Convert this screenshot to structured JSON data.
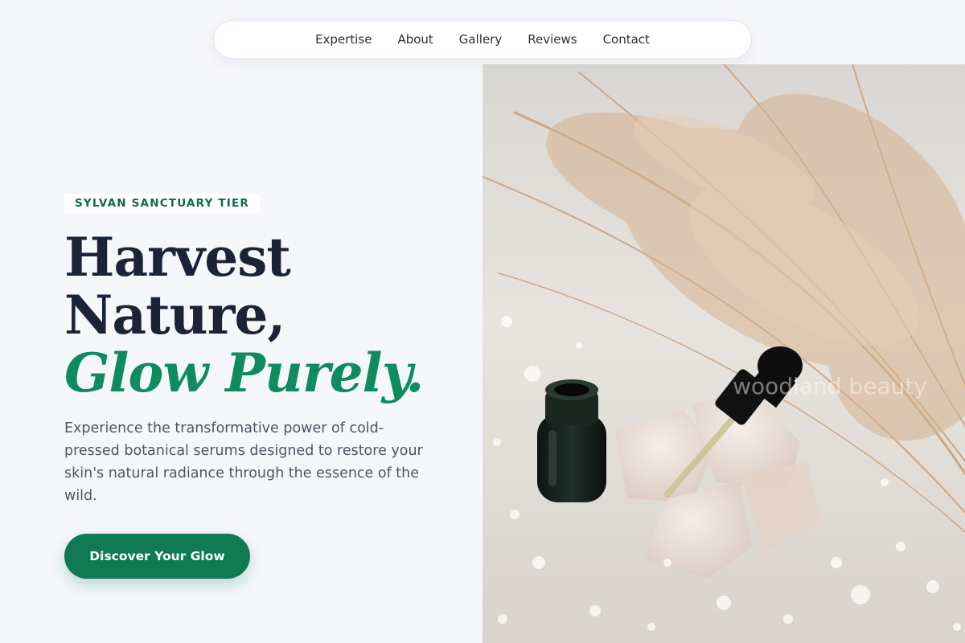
{
  "nav": {
    "items": [
      "Expertise",
      "About",
      "Gallery",
      "Reviews",
      "Contact"
    ]
  },
  "hero": {
    "badge": "SYLVAN SANCTUARY TIER",
    "headline_line1": "Harvest",
    "headline_line2": "Nature,",
    "headline_accent": "Glow Purely.",
    "description": "Experience the transformative power of cold-pressed botanical serums designed to restore your skin's natural radiance through the essence of the wild.",
    "cta_label": "Discover Your Glow"
  },
  "image": {
    "watermark": "woodland beauty"
  },
  "colors": {
    "background": "#f6f7fb",
    "heading": "#1b2436",
    "accent": "#0f8c5f",
    "button": "#0f7a53",
    "badge_text": "#0f6b48"
  }
}
